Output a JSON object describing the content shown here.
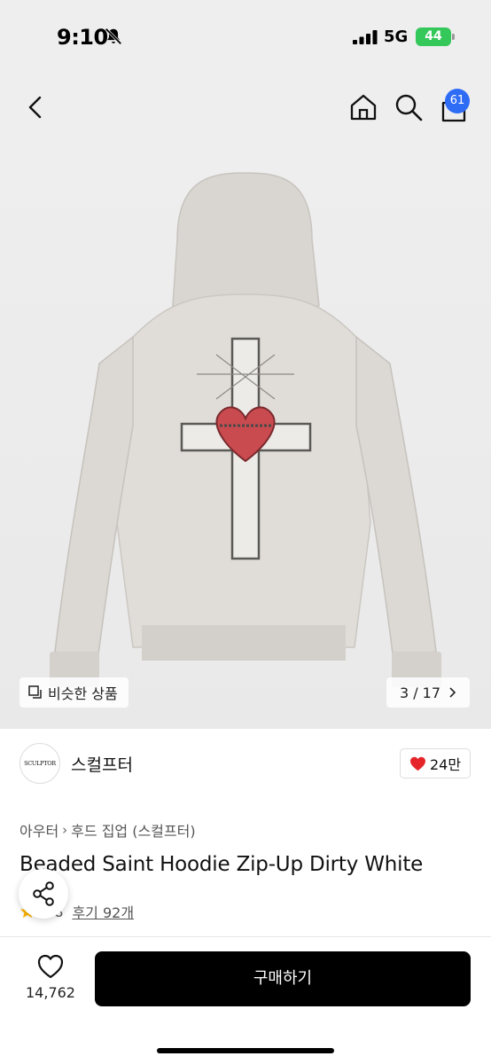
{
  "status_bar": {
    "time": "9:10",
    "network": "5G",
    "battery": "44"
  },
  "header": {
    "cart_count": "61",
    "icons": [
      "back-icon",
      "home-icon",
      "search-icon",
      "cart-icon"
    ]
  },
  "gallery": {
    "similar_label": "비슷한 상품",
    "pager": "3 / 17"
  },
  "brand": {
    "logo_text": "SCULPTOR",
    "name": "스컬프터",
    "likes": "24만"
  },
  "product": {
    "breadcrumb": [
      "아우터",
      "후드 집업 (스컬프터)"
    ],
    "title": "Beaded Saint Hoodie Zip-Up Dirty White",
    "rating": "4.8",
    "reviews": "후기 92개"
  },
  "bottom_bar": {
    "like_count": "14,762",
    "buy_label": "구매하기"
  },
  "colors": {
    "accent": "#2f6cf6",
    "battery": "#34c759",
    "heart": "#e5252a",
    "star": "#ffb400",
    "buy_button": "#000000"
  }
}
